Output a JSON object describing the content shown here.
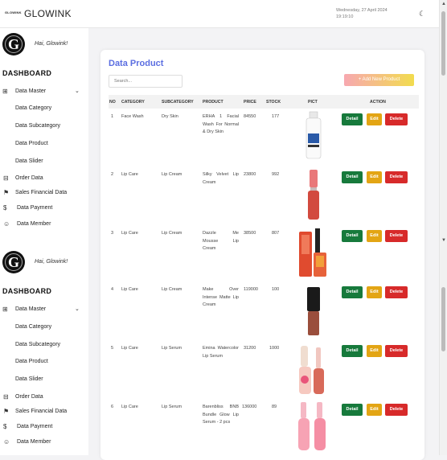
{
  "header": {
    "brand_small": "GLOWINK",
    "brand": "GLOWINK",
    "date_line1": "Wednesday, 27 April 2024",
    "date_line2": "19:19:10",
    "theme_icon": "moon-icon"
  },
  "sidebar": {
    "greeting": "Hai, Glowink!",
    "dashboard_title": "DASHBOARD",
    "data_master": "Data Master",
    "sub_items": [
      "Data Category",
      "Data Subcategory",
      "Data Product",
      "Data Slider"
    ],
    "items": [
      "Order Data",
      "Sales Financial Data",
      "Data Payment",
      "Data Member"
    ]
  },
  "card": {
    "title": "Data Product",
    "search_placeholder": "Search...",
    "add_button": "+ Add New Product",
    "columns": [
      "NO",
      "CATEGORY",
      "SUBCATEGORY",
      "PRODUCT",
      "PRICE",
      "STOCK",
      "PICT",
      "ACTION"
    ],
    "rows": [
      {
        "no": "1",
        "category": "Face Wash",
        "subcategory": "Dry Skin",
        "product": "ERHA 1 Facial Wash For Normal & Dry Skin",
        "price": "84550",
        "stock": "177"
      },
      {
        "no": "2",
        "category": "Lip Care",
        "subcategory": "Lip Cream",
        "product": "Silky Velvet Lip Cream",
        "price": "23800",
        "stock": "992"
      },
      {
        "no": "3",
        "category": "Lip Care",
        "subcategory": "Lip Cream",
        "product": "Dazzle Me Mousse Lip Cream",
        "price": "38500",
        "stock": "807"
      },
      {
        "no": "4",
        "category": "Lip Care",
        "subcategory": "Lip Cream",
        "product": "Make Over Intense Matte Lip Cream",
        "price": "119000",
        "stock": "100"
      },
      {
        "no": "5",
        "category": "Lip Care",
        "subcategory": "Lip Serum",
        "product": "Emina Watercolor Lip Serum",
        "price": "31200",
        "stock": "1000"
      },
      {
        "no": "6",
        "category": "Lip Care",
        "subcategory": "Lip Serum",
        "product": "Barenbliss BNB Bundle Glow Lip Serum - 2 pcs",
        "price": "136000",
        "stock": "89"
      }
    ],
    "actions": {
      "detail": "Detail",
      "edit": "Edit",
      "delete": "Delete"
    }
  },
  "colors": {
    "accent": "#5b6ee1",
    "detail": "#177a3c",
    "edit": "#e3a514",
    "delete": "#d72a2a"
  }
}
